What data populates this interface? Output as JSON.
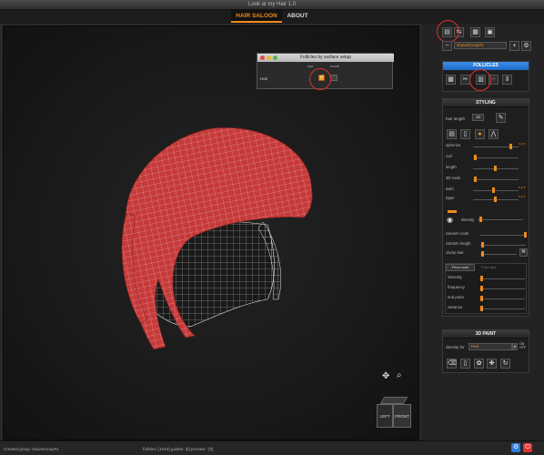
{
  "window": {
    "title": "Look at my Hair 1.0"
  },
  "tabs": [
    {
      "label": "HAIR SALOON",
      "active": true
    },
    {
      "label": "ABOUT",
      "active": false
    }
  ],
  "colors": {
    "accent": "#f08a1c",
    "mesh": "#c63a3a",
    "blue_header": "#2e7bd9",
    "highlight": "#e03030"
  },
  "top_tools": {
    "group_select": "shaveGroup#1",
    "minus_label": "−",
    "plus_label": "+",
    "gear_icon": "gear-icon"
  },
  "follicles_dialog": {
    "title": "Follicles by surface setup",
    "col1": "use",
    "col2": "mode",
    "row_label": "Hair",
    "checked": true
  },
  "follicles": {
    "header": "FOLLICLES"
  },
  "styling": {
    "header": "STYLING",
    "hair_length_label": "hair length",
    "hair_length_value": "10",
    "sliders": [
      {
        "label": "spherize",
        "value": 0.82,
        "tag": "x y z"
      },
      {
        "label": "curl",
        "value": 0.02
      },
      {
        "label": "length",
        "value": 0.45
      },
      {
        "label": "3D roots",
        "value": 0.02
      },
      {
        "label": "swirl",
        "value": 0.42,
        "tag": "x y z"
      },
      {
        "label": "taper",
        "value": 0.45,
        "tag": "x y z"
      }
    ],
    "density_label": "density",
    "sliders2": [
      {
        "label": "random roots",
        "value": 0.98
      },
      {
        "label": "random length",
        "value": 0.02
      },
      {
        "label": "clump hair",
        "value": 0.02
      }
    ],
    "fr_tabs": [
      "Frizz roots",
      "Frizz tips"
    ],
    "fr_sliders": [
      {
        "label": "intensity",
        "value": 0.02
      },
      {
        "label": "frequency",
        "value": 0.02
      },
      {
        "label": "end point",
        "value": 0.02
      },
      {
        "label": "variance",
        "value": 0.02
      }
    ]
  },
  "paint3d": {
    "header": "3D PAINT",
    "density_for_label": "density for",
    "density_for_value": "Hair",
    "on_label": "ON",
    "off_label": "OFF"
  },
  "viewcube": {
    "left": "LEFT",
    "front": "FRONT"
  },
  "status": {
    "created": "Created group: shaveGroup#1",
    "counts": "follicles: [1518] guides: [5] preview : [0]"
  }
}
